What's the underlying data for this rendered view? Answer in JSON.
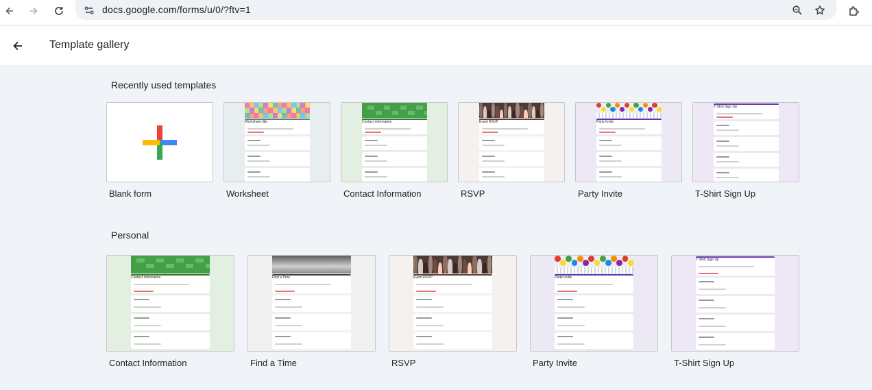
{
  "browser": {
    "url": "docs.google.com/forms/u/0/?ftv=1",
    "icons": [
      "back-arrow-icon",
      "forward-arrow-icon",
      "reload-icon",
      "site-settings-icon",
      "zoom-icon",
      "bookmark-star-icon",
      "extensions-icon"
    ]
  },
  "header": {
    "title": "Template gallery",
    "back_icon": "arrow-left-icon"
  },
  "sections": {
    "recent": {
      "title": "Recently used templates",
      "cards": [
        {
          "label": "Blank form",
          "preview": "blank"
        },
        {
          "label": "Worksheet",
          "preview": "worksheet"
        },
        {
          "label": "Contact Information",
          "preview": "contact"
        },
        {
          "label": "RSVP",
          "preview": "rsvp"
        },
        {
          "label": "Party Invite",
          "preview": "party"
        },
        {
          "label": "T-Shirt Sign Up",
          "preview": "tshirt"
        }
      ]
    },
    "personal": {
      "title": "Personal",
      "cards": [
        {
          "label": "Contact Information",
          "preview": "contact"
        },
        {
          "label": "Find a Time",
          "preview": "findtime"
        },
        {
          "label": "RSVP",
          "preview": "rsvp"
        },
        {
          "label": "Party Invite",
          "preview": "party"
        },
        {
          "label": "T-Shirt Sign Up",
          "preview": "tshirt"
        }
      ]
    }
  },
  "previews": {
    "worksheet": {
      "title": "Worksheet title",
      "bg": "#e8eef0",
      "accent": "#607d8b",
      "banner": "mosaic"
    },
    "contact": {
      "title": "Contact information",
      "bg": "#e3efe0",
      "accent": "#2e7d32",
      "banner": "green"
    },
    "rsvp": {
      "title": "Event RSVP",
      "bg": "#f4f1ee",
      "accent": "#5d4037",
      "banner": "crowd"
    },
    "party": {
      "title": "Party Invite",
      "bg": "#ece9f5",
      "accent": "#5e35b1",
      "banner": "balloons"
    },
    "tshirt": {
      "title": "T-Shirt Sign Up",
      "bg": "#ede7f6",
      "accent": "#673ab7",
      "banner": "none"
    },
    "findtime": {
      "title": "Find a Time",
      "bg": "#f1f1f1",
      "accent": "#424242",
      "banner": "papers"
    }
  },
  "colors": {
    "page_bg": "#f0f4f9",
    "plus_blue": "#4285f4",
    "plus_red": "#ea4335",
    "plus_yellow": "#fbbc04",
    "plus_green": "#34a853"
  }
}
